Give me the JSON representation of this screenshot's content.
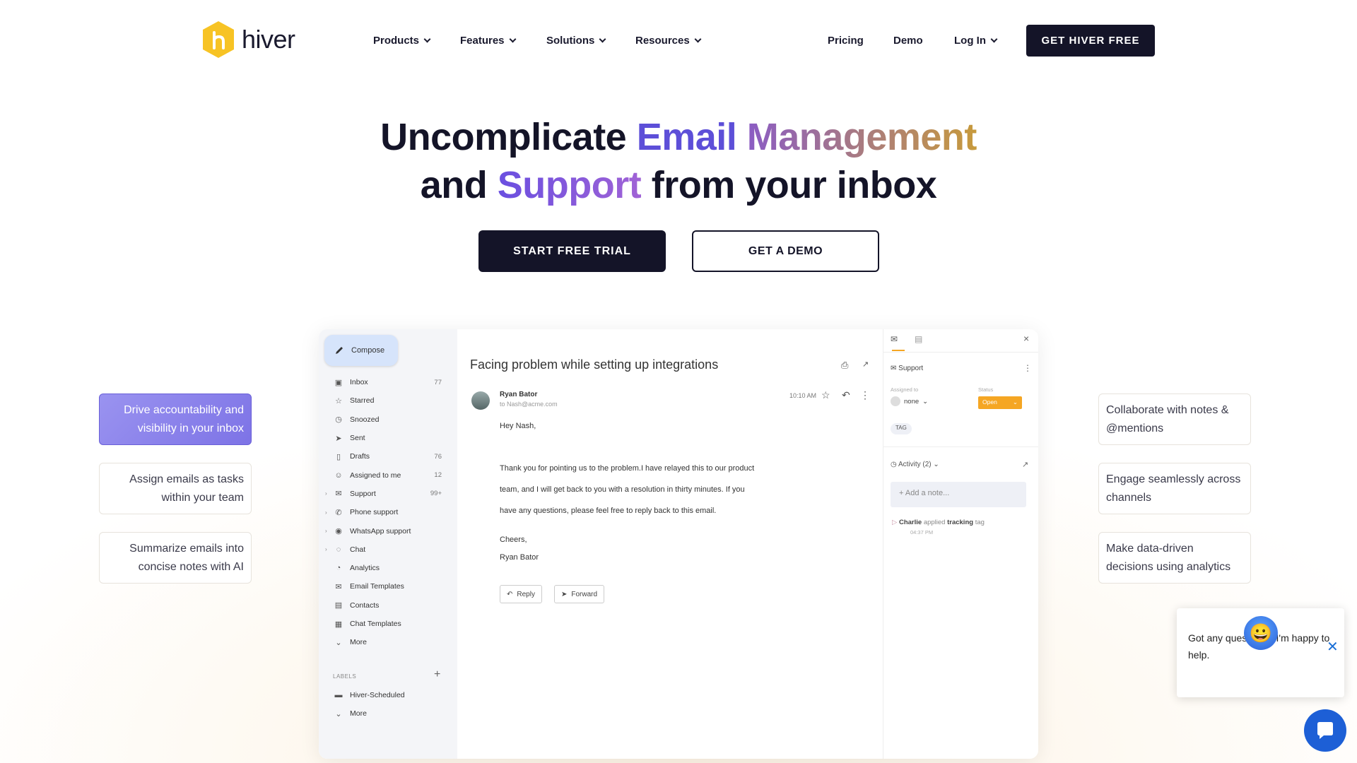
{
  "brand": {
    "name": "hiver"
  },
  "nav": {
    "products": "Products",
    "features": "Features",
    "solutions": "Solutions",
    "resources": "Resources",
    "pricing": "Pricing",
    "demo": "Demo",
    "login": "Log In",
    "cta": "GET HIVER FREE"
  },
  "hero": {
    "line1_a": "Uncomplicate ",
    "line1_b": "Email ",
    "line1_c": "Management",
    "line2_a": "and ",
    "line2_b": "Support",
    "line2_c": " from your inbox",
    "btn_trial": "START FREE TRIAL",
    "btn_demo": "GET A DEMO"
  },
  "features_left": [
    {
      "text": "Drive accountability and visibility in your inbox"
    },
    {
      "text": "Assign emails as tasks within your team"
    },
    {
      "text": "Summarize emails into concise notes with AI"
    }
  ],
  "features_right": [
    {
      "text": "Collaborate with notes & @mentions"
    },
    {
      "text": "Engage seamlessly across channels"
    },
    {
      "text": "Make data-driven decisions using analytics"
    }
  ],
  "app": {
    "compose": "Compose",
    "sidebar": [
      {
        "label": "Inbox",
        "count": "77",
        "icon": "inbox-icon"
      },
      {
        "label": "Starred",
        "count": "",
        "icon": "star-icon"
      },
      {
        "label": "Snoozed",
        "count": "",
        "icon": "clock-icon"
      },
      {
        "label": "Sent",
        "count": "",
        "icon": "send-icon"
      },
      {
        "label": "Drafts",
        "count": "76",
        "icon": "draft-icon"
      },
      {
        "label": "Assigned to me",
        "count": "12",
        "icon": "user-icon"
      },
      {
        "label": "Support",
        "count": "99+",
        "icon": "shared-inbox-icon"
      },
      {
        "label": "Phone support",
        "count": "",
        "icon": "phone-icon"
      },
      {
        "label": "WhatsApp support",
        "count": "",
        "icon": "whatsapp-icon"
      },
      {
        "label": "Chat",
        "count": "",
        "icon": "chat-icon"
      },
      {
        "label": "Analytics",
        "count": "",
        "icon": "analytics-icon"
      },
      {
        "label": "Email Templates",
        "count": "",
        "icon": "template-icon"
      },
      {
        "label": "Contacts",
        "count": "",
        "icon": "contacts-icon"
      },
      {
        "label": "Chat Templates",
        "count": "",
        "icon": "chat-template-icon"
      },
      {
        "label": "More",
        "count": "",
        "icon": "chevron-down-icon"
      }
    ],
    "labels_header": "LABELS",
    "labels": [
      {
        "label": "Hiver-Scheduled",
        "icon": "label-icon"
      },
      {
        "label": "More",
        "icon": "chevron-down-icon"
      }
    ],
    "email": {
      "subject": "Facing problem while setting up integrations",
      "sender": "Ryan Bator",
      "to": "to Nash@acme.com",
      "time": "10:10 AM",
      "greeting": "Hey Nash,",
      "line1": "Thank you for pointing us to the problem.I have relayed this to our product",
      "line2": "team, and I will get back to you with a resolution in thirty minutes. If you",
      "line3": "have any questions, please feel free to reply back to this email.",
      "signoff": "Cheers,",
      "signature": "Ryan Bator",
      "reply": "Reply",
      "forward": "Forward"
    },
    "panel": {
      "inbox_name": "Support",
      "assigned_label": "Assigned to",
      "assigned_value": "none",
      "status_label": "Status",
      "status_value": "Open",
      "tag": "TAG",
      "activity": "Activity (2)",
      "add_note": "Add a note...",
      "activity_user": "Charlie",
      "activity_text": "applied",
      "activity_tag": "tracking",
      "activity_suffix": "tag",
      "activity_time": "04:37 PM"
    }
  },
  "chat": {
    "message": "Got any questions? I'm happy to help."
  },
  "colors": {
    "dark": "#141428",
    "purple": "#5d4fd8",
    "gold": "#c79a3c",
    "status_orange": "#f5a623",
    "chat_blue": "#1d5fd6"
  }
}
